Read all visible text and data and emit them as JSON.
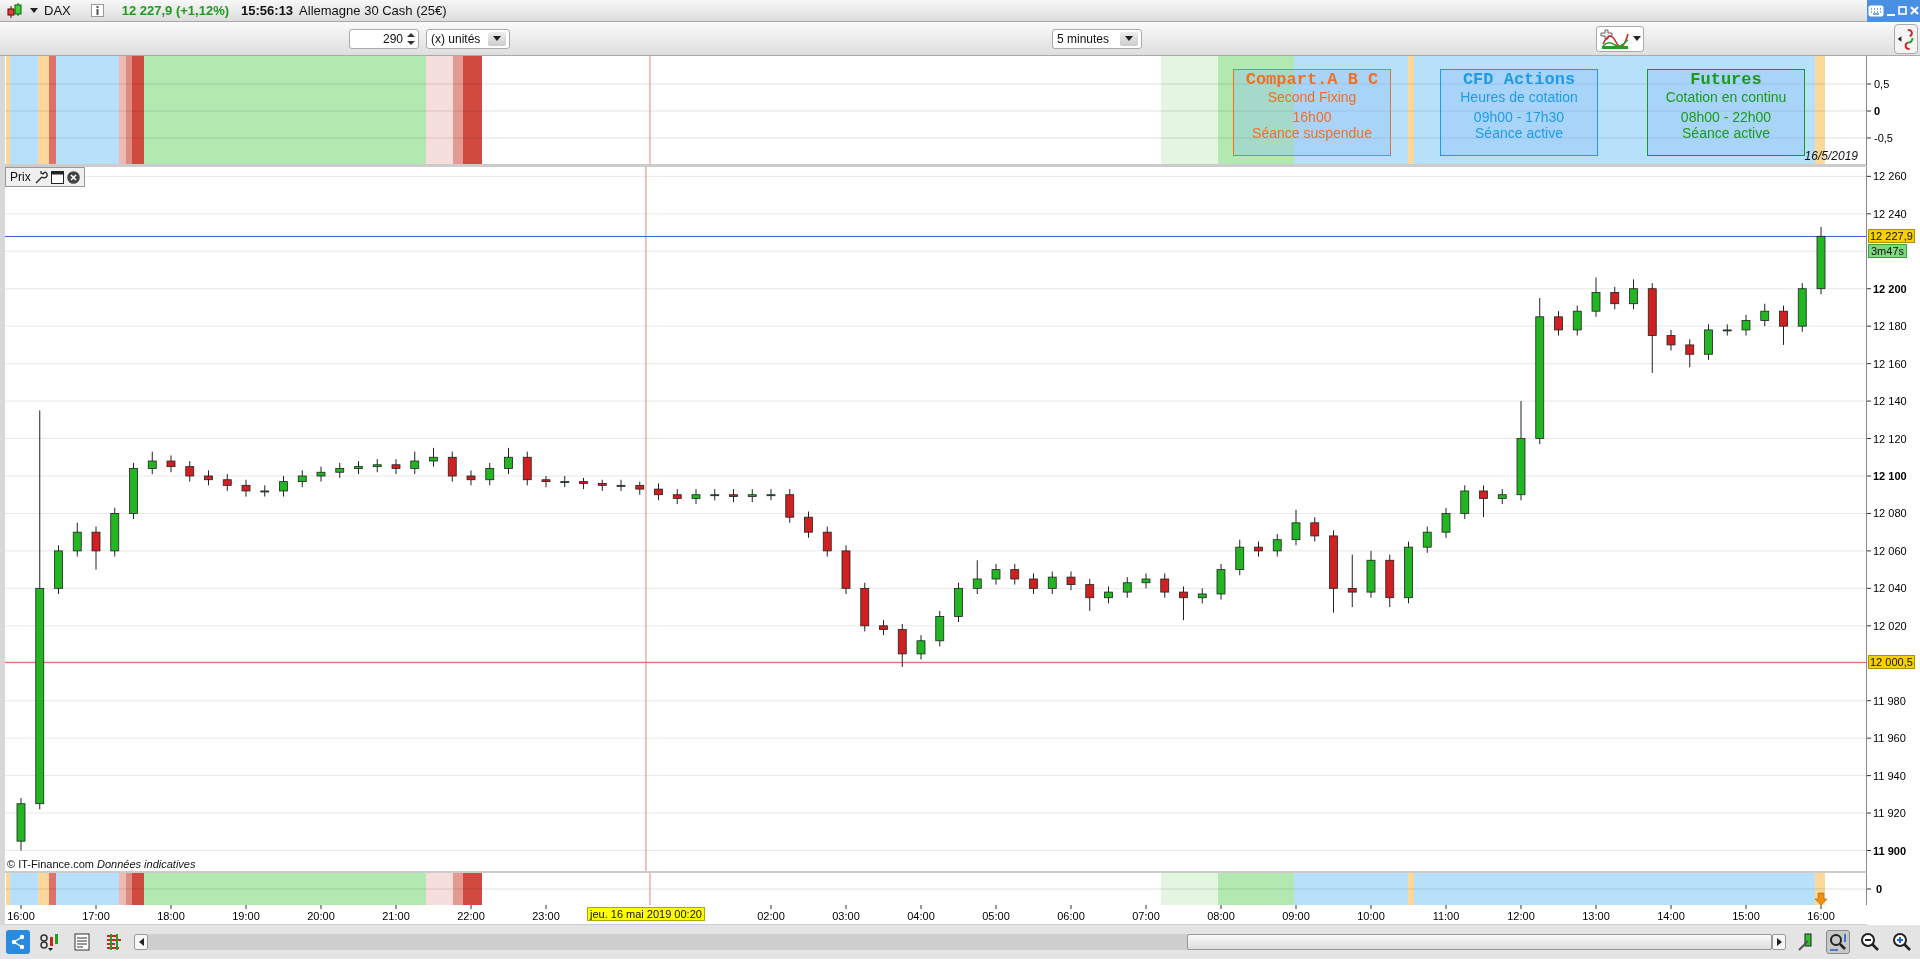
{
  "title_bar": {
    "symbol": "DAX",
    "price": "12 227,9 (+1,12%)",
    "time": "15:56:13",
    "name": "Allemagne 30 Cash (25€)"
  },
  "toolbar": {
    "units_value": "290",
    "units_label": "(x) unités",
    "period": "5 minutes"
  },
  "session_panel": {
    "yticks": [
      "0,5",
      "0",
      "-0,5"
    ],
    "date": "16/5/2019",
    "boxes": [
      {
        "title": "Compart.A B C",
        "subtitle": "Second Fixing",
        "time": "16h00",
        "status": "Séance suspendue",
        "color": "#f07020"
      },
      {
        "title": "CFD Actions",
        "subtitle": "Heures de cotation",
        "time": "09h00 - 17h30",
        "status": "Séance active",
        "color": "#1e9be8"
      },
      {
        "title": "Futures",
        "subtitle": "Cotation en continu",
        "time": "08h00 - 22h00",
        "status": "Séance active",
        "color": "#1a9a1a"
      }
    ]
  },
  "price_panel": {
    "legend": "Prix",
    "footer": "© IT-Finance.com *Données indicatives*",
    "countdown": "3m47s",
    "chart_data": {
      "type": "candlestick",
      "ylim": [
        11888,
        12265
      ],
      "yticks": [
        {
          "value": 12260,
          "label": "12 260"
        },
        {
          "value": 12240,
          "label": "12 240"
        },
        {
          "value": 12200,
          "label": "12 200"
        },
        {
          "value": 12180,
          "label": "12 180"
        },
        {
          "value": 12160,
          "label": "12 160"
        },
        {
          "value": 12140,
          "label": "12 140"
        },
        {
          "value": 12120,
          "label": "12 120"
        },
        {
          "value": 12100,
          "label": "12 100"
        },
        {
          "value": 12080,
          "label": "12 080"
        },
        {
          "value": 12060,
          "label": "12 060"
        },
        {
          "value": 12040,
          "label": "12 040"
        },
        {
          "value": 12020,
          "label": "12 020"
        },
        {
          "value": 11980,
          "label": "11 980"
        },
        {
          "value": 11960,
          "label": "11 960"
        },
        {
          "value": 11940,
          "label": "11 940"
        },
        {
          "value": 11920,
          "label": "11 920"
        },
        {
          "value": 11900,
          "label": "11 900"
        }
      ],
      "categories": [
        "16:00",
        null,
        null,
        null,
        "17:00",
        null,
        null,
        null,
        "18:00",
        null,
        null,
        null,
        "19:00",
        null,
        null,
        null,
        "20:00",
        null,
        null,
        null,
        "21:00",
        null,
        null,
        null,
        "22:00",
        null,
        null,
        null,
        "23:00",
        null,
        null,
        null,
        null,
        null,
        null,
        null,
        null,
        null,
        null,
        null,
        "02:00",
        null,
        null,
        null,
        "03:00",
        null,
        null,
        null,
        "04:00",
        null,
        null,
        null,
        "05:00",
        null,
        null,
        null,
        "06:00",
        null,
        null,
        null,
        "07:00",
        null,
        null,
        null,
        "08:00",
        null,
        null,
        null,
        "09:00",
        null,
        null,
        null,
        "10:00",
        null,
        null,
        null,
        "11:00",
        null,
        null,
        null,
        "12:00",
        null,
        null,
        null,
        "13:00",
        null,
        null,
        null,
        "14:00",
        null,
        null,
        null,
        "15:00",
        null,
        null,
        null,
        "16:00"
      ],
      "ohlc": [
        [
          11905,
          11928,
          11900,
          11925
        ],
        [
          11925,
          12135,
          11922,
          12040
        ],
        [
          12040,
          12063,
          12037,
          12060
        ],
        [
          12060,
          12075,
          12057,
          12070
        ],
        [
          12070,
          12073,
          12050,
          12060
        ],
        [
          12060,
          12083,
          12057,
          12080
        ],
        [
          12080,
          12107,
          12077,
          12104
        ],
        [
          12104,
          12113,
          12101,
          12108
        ],
        [
          12108,
          12111,
          12102,
          12105
        ],
        [
          12105,
          12108,
          12097,
          12100
        ],
        [
          12100,
          12103,
          12095,
          12098
        ],
        [
          12098,
          12101,
          12092,
          12095
        ],
        [
          12095,
          12098,
          12089,
          12092
        ],
        [
          12092,
          12095,
          12089,
          12092
        ],
        [
          12092,
          12100,
          12089,
          12097
        ],
        [
          12097,
          12103,
          12094,
          12100
        ],
        [
          12100,
          12105,
          12097,
          12102
        ],
        [
          12102,
          12107,
          12099,
          12104
        ],
        [
          12104,
          12108,
          12101,
          12105
        ],
        [
          12105,
          12109,
          12102,
          12106
        ],
        [
          12106,
          12109,
          12101,
          12104
        ],
        [
          12104,
          12113,
          12101,
          12108
        ],
        [
          12108,
          12115,
          12105,
          12110
        ],
        [
          12110,
          12113,
          12097,
          12100
        ],
        [
          12100,
          12103,
          12095,
          12098
        ],
        [
          12098,
          12107,
          12095,
          12104
        ],
        [
          12104,
          12115,
          12101,
          12110
        ],
        [
          12110,
          12113,
          12095,
          12098
        ],
        [
          12098,
          12100,
          12094,
          12097
        ],
        [
          12097,
          12100,
          12094,
          12097
        ],
        [
          12097,
          12099,
          12093,
          12096
        ],
        [
          12096,
          12098,
          12092,
          12095
        ],
        [
          12095,
          12098,
          12092,
          12095
        ],
        [
          12095,
          12097,
          12090,
          12093
        ],
        [
          12093,
          12096,
          12087,
          12090
        ],
        [
          12090,
          12093,
          12085,
          12088
        ],
        [
          12088,
          12093,
          12085,
          12090
        ],
        [
          12090,
          12093,
          12087,
          12090
        ],
        [
          12090,
          12093,
          12086,
          12089
        ],
        [
          12089,
          12093,
          12086,
          12090
        ],
        [
          12090,
          12093,
          12087,
          12090
        ],
        [
          12090,
          12093,
          12075,
          12078
        ],
        [
          12078,
          12081,
          12067,
          12070
        ],
        [
          12070,
          12073,
          12057,
          12060
        ],
        [
          12060,
          12063,
          12037,
          12040
        ],
        [
          12040,
          12043,
          12017,
          12020
        ],
        [
          12020,
          12023,
          12015,
          12018
        ],
        [
          12018,
          12021,
          11998,
          12005
        ],
        [
          12005,
          12015,
          12002,
          12012
        ],
        [
          12012,
          12028,
          12009,
          12025
        ],
        [
          12025,
          12043,
          12022,
          12040
        ],
        [
          12040,
          12055,
          12037,
          12045
        ],
        [
          12045,
          12053,
          12042,
          12050
        ],
        [
          12050,
          12053,
          12042,
          12045
        ],
        [
          12045,
          12048,
          12037,
          12040
        ],
        [
          12040,
          12049,
          12037,
          12046
        ],
        [
          12046,
          12049,
          12039,
          12042
        ],
        [
          12042,
          12045,
          12028,
          12035
        ],
        [
          12035,
          12041,
          12032,
          12038
        ],
        [
          12038,
          12046,
          12035,
          12043
        ],
        [
          12043,
          12048,
          12040,
          12045
        ],
        [
          12045,
          12048,
          12035,
          12038
        ],
        [
          12038,
          12041,
          12023,
          12035
        ],
        [
          12035,
          12040,
          12032,
          12037
        ],
        [
          12037,
          12053,
          12034,
          12050
        ],
        [
          12050,
          12066,
          12047,
          12062
        ],
        [
          12062,
          12065,
          12057,
          12060
        ],
        [
          12060,
          12069,
          12057,
          12066
        ],
        [
          12066,
          12082,
          12063,
          12075
        ],
        [
          12075,
          12078,
          12065,
          12068
        ],
        [
          12068,
          12071,
          12027,
          12040
        ],
        [
          12040,
          12058,
          12030,
          12038
        ],
        [
          12038,
          12060,
          12035,
          12055
        ],
        [
          12055,
          12058,
          12030,
          12035
        ],
        [
          12035,
          12065,
          12032,
          12062
        ],
        [
          12062,
          12073,
          12059,
          12070
        ],
        [
          12070,
          12083,
          12067,
          12080
        ],
        [
          12080,
          12095,
          12077,
          12092
        ],
        [
          12092,
          12095,
          12078,
          12088
        ],
        [
          12088,
          12093,
          12085,
          12090
        ],
        [
          12090,
          12140,
          12087,
          12120
        ],
        [
          12120,
          12195,
          12117,
          12185
        ],
        [
          12185,
          12188,
          12175,
          12178
        ],
        [
          12178,
          12191,
          12175,
          12188
        ],
        [
          12188,
          12206,
          12185,
          12198
        ],
        [
          12198,
          12201,
          12189,
          12192
        ],
        [
          12192,
          12205,
          12189,
          12200
        ],
        [
          12200,
          12203,
          12155,
          12175
        ],
        [
          12175,
          12178,
          12167,
          12170
        ],
        [
          12170,
          12173,
          12158,
          12165
        ],
        [
          12165,
          12181,
          12162,
          12178
        ],
        [
          12178,
          12181,
          12175,
          12178
        ],
        [
          12178,
          12186,
          12175,
          12183
        ],
        [
          12183,
          12192,
          12180,
          12188
        ],
        [
          12188,
          12191,
          12170,
          12180
        ],
        [
          12180,
          12203,
          12177,
          12200
        ],
        [
          12200,
          12233,
          12197,
          12228
        ]
      ],
      "grid": true,
      "ref_lines": [
        {
          "axis": "y",
          "value": 12227.9,
          "label": "12 227,9",
          "color": "#3060d0"
        },
        {
          "axis": "y",
          "value": 12000.5,
          "label": "12 000,5",
          "color": "#e85050"
        }
      ]
    },
    "crosshair_label": "jeu. 16 mai 2019 00:20"
  },
  "oscillator_panel": {
    "yticks": [
      "0"
    ]
  }
}
